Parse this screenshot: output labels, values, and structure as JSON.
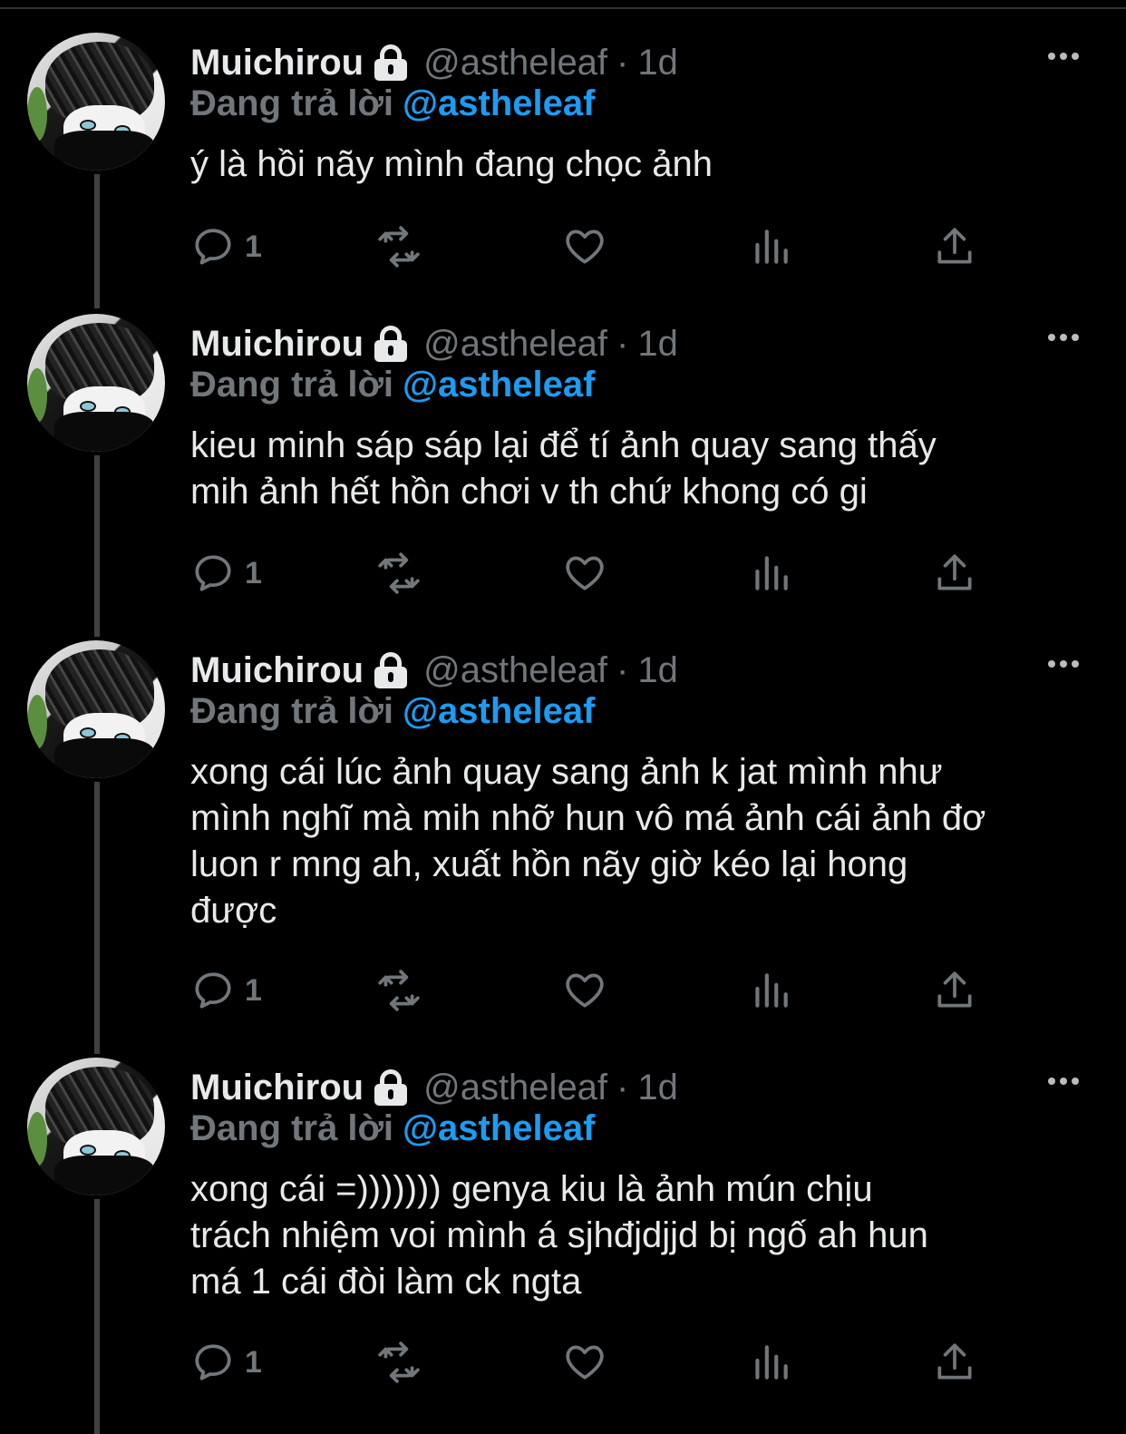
{
  "tweets": [
    {
      "name": "Muichirou",
      "handle": "@astheleaf",
      "separator": "·",
      "time": "1d",
      "replying_prefix": "Đang trả lời",
      "replying_to": "@astheleaf",
      "text_lines": [
        "ý là hồi nãy mình đang chọc ảnh"
      ],
      "reply_count": "1"
    },
    {
      "name": "Muichirou",
      "handle": "@astheleaf",
      "separator": "·",
      "time": "1d",
      "replying_prefix": "Đang trả lời",
      "replying_to": "@astheleaf",
      "text_lines": [
        "kieu minh sáp sáp lại để tí ảnh quay sang thấy",
        "mih ảnh hết hồn chơi v th chứ khong có gi"
      ],
      "reply_count": "1"
    },
    {
      "name": "Muichirou",
      "handle": "@astheleaf",
      "separator": "·",
      "time": "1d",
      "replying_prefix": "Đang trả lời",
      "replying_to": "@astheleaf",
      "text_lines": [
        "xong cái lúc ảnh quay sang ảnh k jat mình như",
        "mình nghĩ mà mih nhỡ hun vô má ảnh cái ảnh đơ",
        "luon r mng ah, xuất hồn nãy giờ kéo lại hong",
        "được"
      ],
      "reply_count": "1"
    },
    {
      "name": "Muichirou",
      "handle": "@astheleaf",
      "separator": "·",
      "time": "1d",
      "replying_prefix": "Đang trả lời",
      "replying_to": "@astheleaf",
      "text_lines": [
        "xong cái =))))))) genya kiu là ảnh mún chịu",
        "trách nhiệm voi mình á sjhđjdjjd bị ngố ah hun",
        "má 1 cái đòi làm ck ngta"
      ],
      "reply_count": "1"
    }
  ],
  "icons": {
    "reply": "reply-bubble-icon",
    "retweet": "retweet-icon",
    "like": "heart-icon",
    "views": "views-chart-icon",
    "share": "share-icon",
    "more": "more-dots-icon",
    "lock": "lock-icon"
  },
  "colors": {
    "background": "#000000",
    "text": "#e7e9ea",
    "muted": "#71767b",
    "accent": "#1d9bf0",
    "thread_line": "#3e4144"
  }
}
